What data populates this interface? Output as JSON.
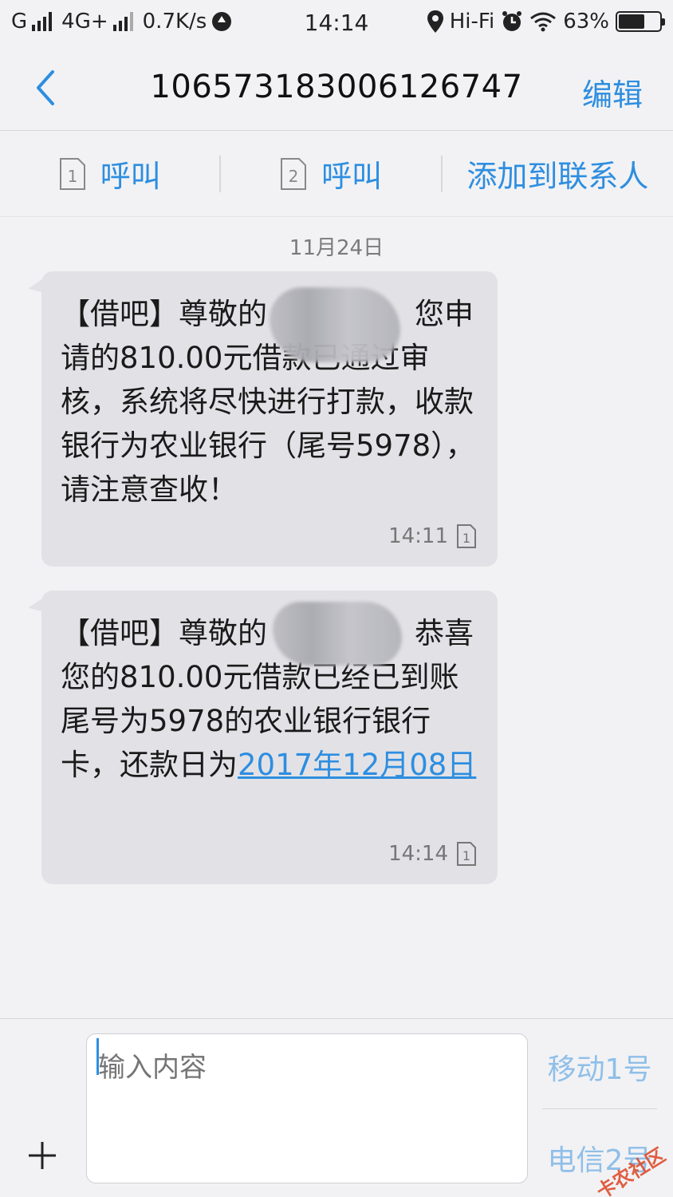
{
  "status_bar": {
    "carrier": "G",
    "network": "4G+",
    "speed": "0.7K/s",
    "time": "14:14",
    "hifi": "Hi-Fi",
    "battery": "63%",
    "battery_level": 0.63
  },
  "header": {
    "title": "10657318300612674​7",
    "edit_label": "编辑"
  },
  "actions": {
    "call1_sim": "1",
    "call1_label": "呼叫",
    "call2_sim": "2",
    "call2_label": "呼叫",
    "add_contact_label": "添加到联系人"
  },
  "conversation": {
    "date": "11月24日",
    "messages": [
      {
        "text": "【借吧】尊敬的　　　　　您申请的810.00元借款已通过审核，系统将尽快进行打款，收款银行为农业银行（尾号5978），请注意查收！",
        "time": "14:11",
        "sim": "1"
      },
      {
        "text_before": "【借吧】尊敬的　　　　　恭喜您的810.00元借款已经已到账尾号为5978的农业银行银行卡，还款日为",
        "link": "2017年12月08日",
        "time": "14:14",
        "sim": "1"
      }
    ]
  },
  "composer": {
    "placeholder": "输入内容",
    "send_sim1": "移动1号",
    "send_sim2": "电信2号"
  },
  "watermark": "卡农社区",
  "colors": {
    "accent": "#2e8ee0",
    "bubble": "#e2e2e6",
    "background": "#f2f2f4"
  }
}
